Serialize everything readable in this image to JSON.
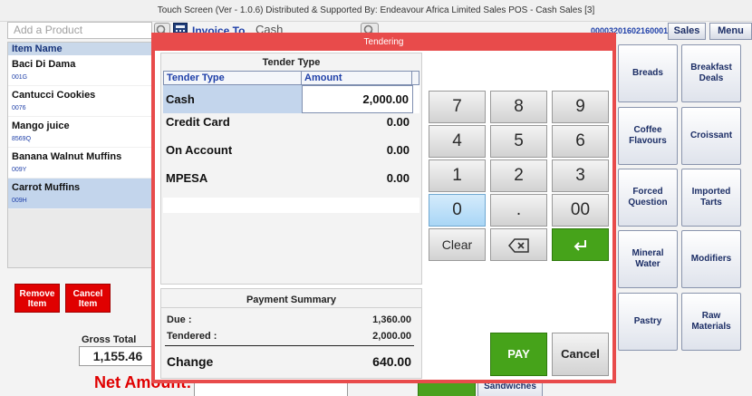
{
  "window": {
    "title": "Touch Screen (Ver - 1.0.6) Distributed & Supported By: Endeavour Africa Limited Sales POS - Cash Sales [3]"
  },
  "toolbar": {
    "product_placeholder": "Add a Product",
    "invoice_to_label": "Invoice To",
    "invoice_to_value": "Cash",
    "invoice_number": "00003201602160001",
    "sales_label": "Sales",
    "menu_label": "Menu"
  },
  "items": {
    "header": "Item Name",
    "rows": [
      {
        "name": "Baci Di Dama",
        "code": "001G"
      },
      {
        "name": "Cantucci Cookies",
        "code": "0076"
      },
      {
        "name": "Mango juice",
        "code": "8569Q"
      },
      {
        "name": "Banana Walnut Muffins",
        "code": "009Y"
      },
      {
        "name": "Carrot Muffins",
        "code": "009H"
      }
    ],
    "remove_item": "Remove Item",
    "cancel_item": "Cancel Item"
  },
  "totals": {
    "gross_total_label": "Gross Total",
    "gross_total_value": "1,155.46",
    "net_amount_label": "Net Amount:",
    "sandwiches_label": "Sandwiches"
  },
  "categories": [
    "Breads",
    "Breakfast Deals",
    "Coffee Flavours",
    "Croissant",
    "Forced Question",
    "Imported Tarts",
    "Mineral Water",
    "Modifiers",
    "Pastry",
    "Raw Materials"
  ],
  "modal": {
    "title": "Tendering",
    "tender_type_heading": "Tender Type",
    "columns": [
      "Tender Type",
      "Amount"
    ],
    "tenders": [
      {
        "type": "Cash",
        "amount": "2,000.00"
      },
      {
        "type": "Credit Card",
        "amount": "0.00"
      },
      {
        "type": "On Account",
        "amount": "0.00"
      },
      {
        "type": "MPESA",
        "amount": "0.00"
      }
    ],
    "payment_summary_heading": "Payment Summary",
    "due_label": "Due :",
    "due_value": "1,360.00",
    "tendered_label": "Tendered :",
    "tendered_value": "2,000.00",
    "change_label": "Change",
    "change_value": "640.00",
    "keypad": [
      "7",
      "8",
      "9",
      "4",
      "5",
      "6",
      "1",
      "2",
      "3",
      "0",
      ".",
      "00"
    ],
    "clear_label": "Clear",
    "pay_label": "PAY",
    "cancel_label": "Cancel"
  }
}
